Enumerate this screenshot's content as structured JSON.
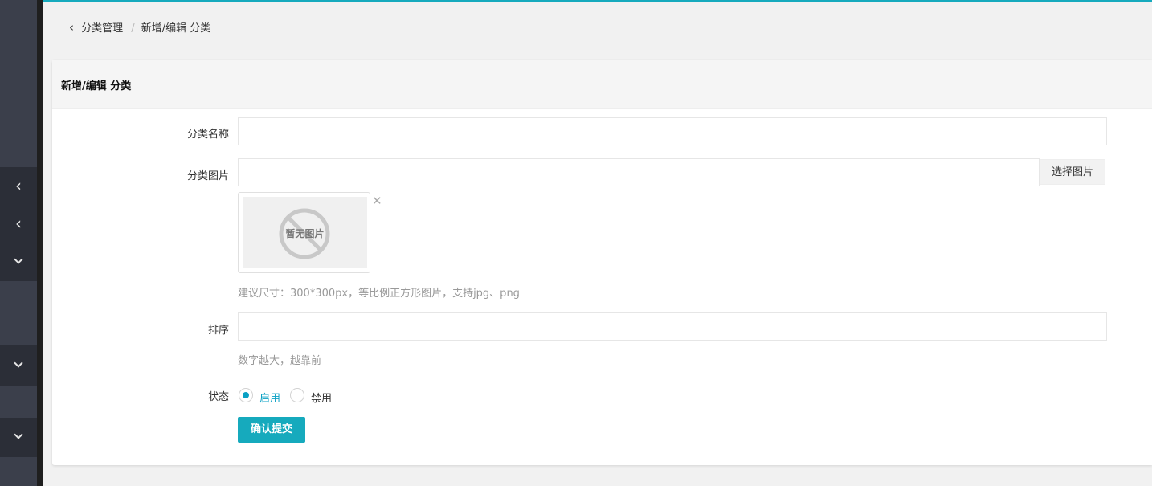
{
  "breadcrumb": {
    "back": "分类管理",
    "separator": "/",
    "current": "新增/编辑 分类"
  },
  "panel": {
    "title": "新增/编辑 分类"
  },
  "form": {
    "name_label": "分类名称",
    "name_value": "",
    "image_label": "分类图片",
    "image_value": "",
    "choose_image_button": "选择图片",
    "no_image_text": "暂无图片",
    "image_hint": "建议尺寸：300*300px，等比例正方形图片，支持jpg、png",
    "sort_label": "排序",
    "sort_value": "",
    "sort_hint": "数字越大，越靠前",
    "status_label": "状态",
    "status_enabled": "启用",
    "status_disabled": "禁用",
    "status_selected": "启用",
    "submit_button": "确认提交"
  },
  "colors": {
    "accent": "#16aabd",
    "radio_active": "#0aa1c4",
    "sidebar": "#393d49"
  },
  "sidebar": {
    "icons": [
      "chevron-left-icon",
      "chevron-left-icon",
      "chevron-down-icon",
      "chevron-down-icon",
      "chevron-down-icon"
    ]
  }
}
